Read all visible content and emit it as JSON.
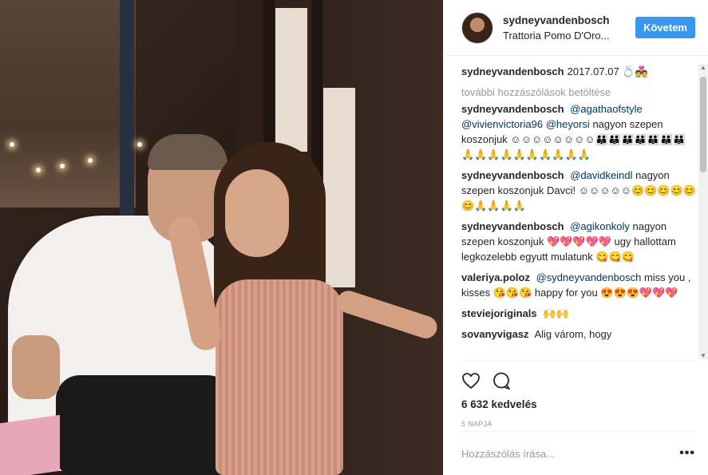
{
  "header": {
    "username": "sydneyvandenbosch",
    "location": "Trattoria Pomo D'Oro...",
    "follow_label": "Követem"
  },
  "caption": {
    "author": "sydneyvandenbosch",
    "text": "2017.07.07 💍💑"
  },
  "load_more": "további hozzászólások betöltése",
  "comments": [
    {
      "author": "sydneyvandenbosch",
      "mentions": [
        "@agathaofstyle",
        "@vivienvictoria96",
        "@heyorsi"
      ],
      "text": "nagyon szepen koszonjuk ☺☺☺☺☺☺☺☺👪👪👪👪👪👪👪🙏🙏🙏🙏🙏🙏🙏🙏🙏🙏"
    },
    {
      "author": "sydneyvandenbosch",
      "mentions": [
        "@davidkeindl"
      ],
      "text": "nagyon szepen koszonjuk Davci! ☺☺☺☺☺😊😊😊😊😊😊🙏🙏🙏🙏"
    },
    {
      "author": "sydneyvandenbosch",
      "mentions": [
        "@agikonkoly"
      ],
      "text": "nagyon szepen koszonjuk 💖💖💖💖💖 ugy hallottam legkozelebb egyutt mulatunk 😋😋😋"
    },
    {
      "author": "valeriya.poloz",
      "mentions": [
        "@sydneyvandenbosch"
      ],
      "text": "miss you , kisses 😘😘😘 happy for you 😍😍😍💖💖💖"
    },
    {
      "author": "steviejoriginals",
      "mentions": [],
      "text": "🙌🙌"
    },
    {
      "author": "sovanyvigasz",
      "mentions": [],
      "text": "Alig várom, hogy"
    }
  ],
  "actions": {
    "likes": "6 632 kedvelés",
    "date": "5 NAPJA"
  },
  "add_comment": {
    "placeholder": "Hozzászólás írása..."
  },
  "icons": {
    "like": "heart-icon",
    "comment": "comment-icon",
    "more": "more-options-icon"
  },
  "colors": {
    "accent": "#3897f0",
    "mention": "#003569",
    "muted": "#999999"
  }
}
